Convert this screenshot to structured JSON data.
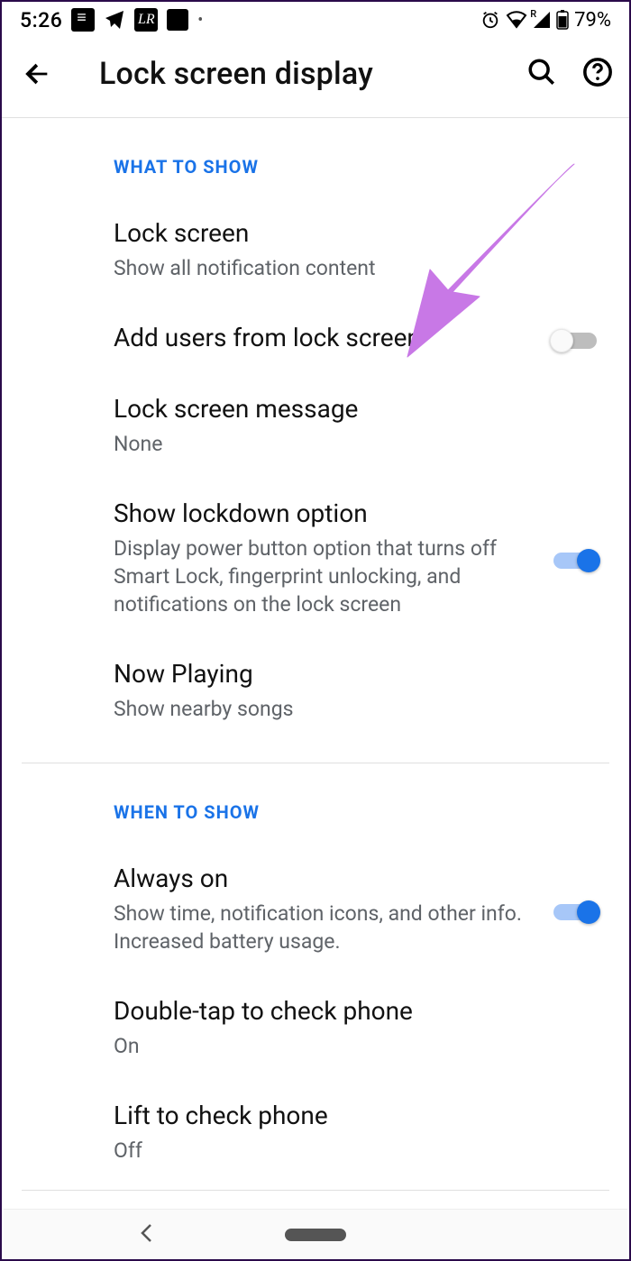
{
  "status": {
    "time": "5:26",
    "battery_pct": "79%"
  },
  "header": {
    "title": "Lock screen display"
  },
  "sections": {
    "what_to_show": {
      "heading": "What to show",
      "items": {
        "lock_screen": {
          "title": "Lock screen",
          "sub": "Show all notification content"
        },
        "add_users": {
          "title": "Add users from lock screen",
          "toggle": "off"
        },
        "lock_msg": {
          "title": "Lock screen message",
          "sub": "None"
        },
        "lockdown": {
          "title": "Show lockdown option",
          "sub": "Display power button option that turns off Smart Lock, fingerprint unlocking, and notifications on the lock screen",
          "toggle": "on"
        },
        "now_playing": {
          "title": "Now Playing",
          "sub": "Show nearby songs"
        }
      }
    },
    "when_to_show": {
      "heading": "When to show",
      "items": {
        "always_on": {
          "title": "Always on",
          "sub": "Show time, notification icons, and other info. Increased battery usage.",
          "toggle": "on"
        },
        "double_tap": {
          "title": "Double-tap to check phone",
          "sub": "On"
        },
        "lift": {
          "title": "Lift to check phone",
          "sub": "Off"
        }
      }
    }
  }
}
